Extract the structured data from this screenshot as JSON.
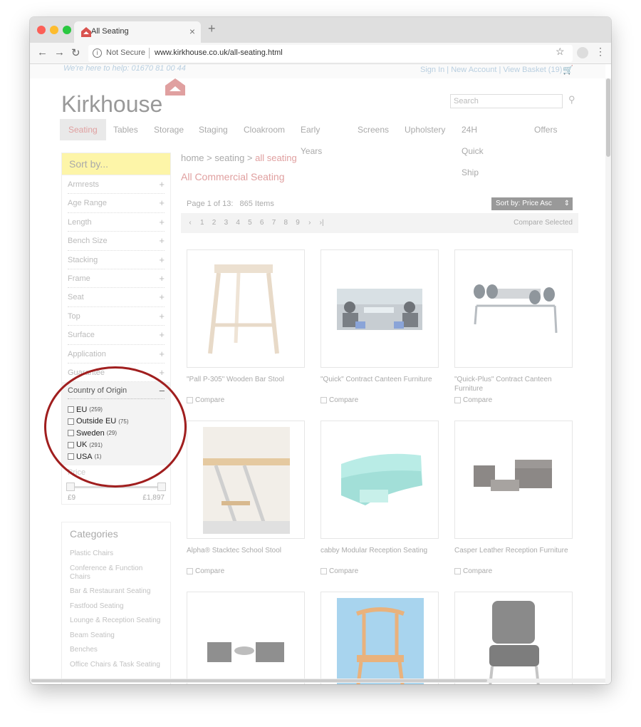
{
  "browser": {
    "tab_title": "All Seating",
    "tab_close": "×",
    "new_tab": "+",
    "security": "Not Secure",
    "url": "www.kirkhouse.co.uk/all-seating.html",
    "back_icon": "arrow-left",
    "forward_icon": "arrow-right",
    "reload_icon": "reload"
  },
  "site": {
    "help_line": "We're here to help: 01670 81 00 44",
    "sign_in": "Sign In",
    "new_account": "New Account",
    "view_basket": "View Basket (19)",
    "logo": "Kirkhouse",
    "search_placeholder": "Search"
  },
  "nav": [
    "Seating",
    "Tables",
    "Storage",
    "Staging",
    "Cloakroom",
    "Early Years",
    "Screens",
    "Upholstery",
    "24H Quick Ship",
    "Offers"
  ],
  "sidebar": {
    "sort_by": "Sort by...",
    "filters": [
      "Armrests",
      "Age Range",
      "Length",
      "Bench Size",
      "Stacking",
      "Frame",
      "Seat",
      "Top",
      "Surface",
      "Application",
      "Guarantee"
    ],
    "origin": {
      "title": "Country of Origin",
      "options": [
        {
          "label": "EU",
          "count": "(259)"
        },
        {
          "label": "Outside EU",
          "count": "(75)"
        },
        {
          "label": "Sweden",
          "count": "(29)"
        },
        {
          "label": "UK",
          "count": "(291)"
        },
        {
          "label": "USA",
          "count": "(1)"
        }
      ]
    },
    "price": {
      "title": "Price",
      "min": "£9",
      "max": "£1,897"
    },
    "categories_title": "Categories",
    "categories": [
      "Plastic Chairs",
      "Conference & Function Chairs",
      "Bar & Restaurant Seating",
      "Fastfood Seating",
      "Lounge & Reception Seating",
      "Beam Seating",
      "Benches",
      "Office Chairs & Task Seating"
    ]
  },
  "content": {
    "crumb_home": "home",
    "crumb_seating": "seating",
    "crumb_current": "all seating",
    "crumb_sep": ">",
    "title": "All Commercial Seating",
    "page_info": "Page 1 of 13:",
    "item_count": "865 Items",
    "sort_label": "Sort by:  Price Asc",
    "pages": [
      "1",
      "2",
      "3",
      "4",
      "5",
      "6",
      "7",
      "8",
      "9"
    ],
    "compare_selected": "Compare Selected",
    "compare": "Compare",
    "products": [
      {
        "name": "\"Pall P-305\" Wooden Bar Stool"
      },
      {
        "name": "\"Quick\" Contract Canteen Furniture"
      },
      {
        "name": "\"Quick-Plus\" Contract Canteen Furniture"
      },
      {
        "name": "Alpha® Stacktec School Stool"
      },
      {
        "name": "cabby Modular Reception Seating"
      },
      {
        "name": "Casper Leather Reception Furniture"
      }
    ]
  },
  "colors": {
    "accent": "#e0a0a0",
    "highlight": "#fdf5a8",
    "annotation": "#a01e1e"
  }
}
